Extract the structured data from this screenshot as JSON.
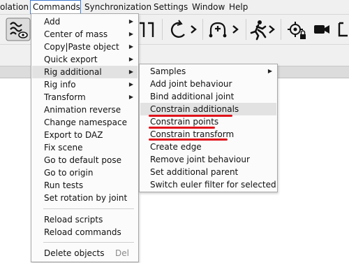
{
  "menubar": {
    "items": [
      "olation",
      "Commands",
      "Synchronization",
      "Settings",
      "Window",
      "Help"
    ]
  },
  "toolbar": {
    "icons": [
      "layers-eye-icon",
      "frame-icon",
      "rotate-icon",
      "add-node-icon",
      "running-figure-icon",
      "locked-target-icon",
      "camera-icon",
      "crop-icon"
    ]
  },
  "commands_menu": {
    "items": [
      {
        "label": "Add",
        "submenu": true
      },
      {
        "label": "Center of mass",
        "submenu": true
      },
      {
        "label": "Copy|Paste object",
        "submenu": true
      },
      {
        "label": "Quick export",
        "submenu": true
      },
      {
        "label": "Rig additional",
        "submenu": true
      },
      {
        "label": "Rig info",
        "submenu": true
      },
      {
        "label": "Transform",
        "submenu": true
      },
      {
        "label": "Animation reverse"
      },
      {
        "label": "Change namespace"
      },
      {
        "label": "Export to DAZ"
      },
      {
        "label": "Fix scene"
      },
      {
        "label": "Go to default pose"
      },
      {
        "label": "Go to origin"
      },
      {
        "label": "Run tests"
      },
      {
        "label": "Set rotation by joint"
      }
    ],
    "group2": [
      {
        "label": "Reload scripts"
      },
      {
        "label": "Reload commands"
      }
    ],
    "group3": [
      {
        "label": "Delete objects",
        "shortcut": "Del"
      }
    ]
  },
  "rig_additional_submenu": {
    "items": [
      {
        "label": "Samples",
        "submenu": true
      },
      {
        "label": "Add joint behaviour"
      },
      {
        "label": "Bind additional joint"
      },
      {
        "label": "Constrain additionals"
      },
      {
        "label": "Constrain points"
      },
      {
        "label": "Constrain transform"
      },
      {
        "label": "Create edge"
      },
      {
        "label": "Remove joint behaviour"
      },
      {
        "label": "Set additional parent"
      },
      {
        "label": "Switch euler filter for selected"
      }
    ]
  },
  "colors": {
    "annotation_red": "#e0121a",
    "menu_highlight": "#e2e2e2",
    "active_border": "#3e7ad0"
  }
}
